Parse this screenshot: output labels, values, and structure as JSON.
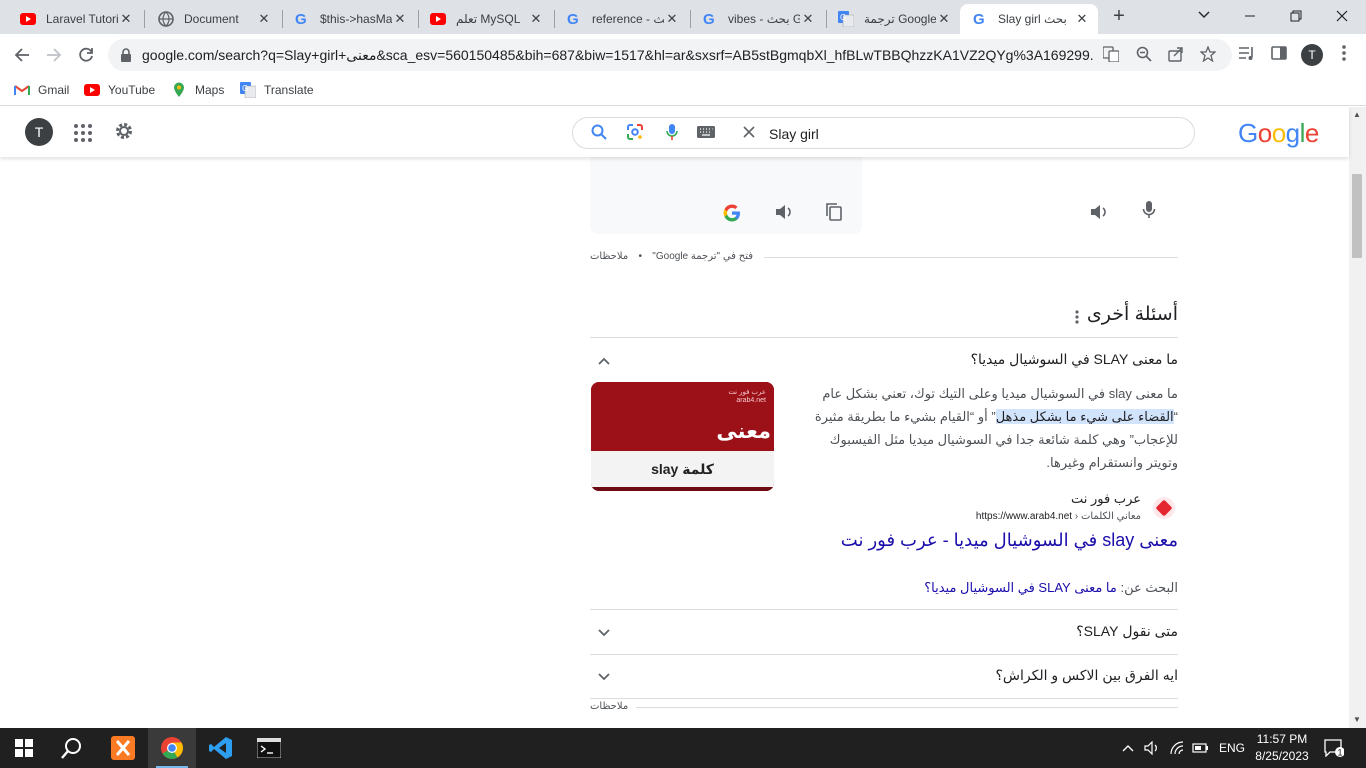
{
  "browser": {
    "tabs": [
      {
        "title": "Laravel Tutori",
        "favicon": "youtube-icon",
        "active": false
      },
      {
        "title": "Document",
        "favicon": "globe-icon",
        "active": false
      },
      {
        "title": "$this->hasMa",
        "favicon": "google-icon",
        "active": false
      },
      {
        "title": "تعلم MySQL",
        "favicon": "youtube-icon",
        "active": false
      },
      {
        "title": "reference - بحث",
        "favicon": "google-icon",
        "active": false
      },
      {
        "title": "vibes - بحث G",
        "favicon": "google-icon",
        "active": false
      },
      {
        "title": "ترجمة Google",
        "favicon": "google-translate-icon",
        "active": false
      },
      {
        "title": "Slay girl بحث",
        "favicon": "google-icon",
        "active": true
      }
    ],
    "new_tab_symbol": "+",
    "url": "google.com/search?q=Slay+girl+معنى&sca_esv=560150485&bih=687&biw=1517&hl=ar&sxsrf=AB5stBgmqbXl_hfBLwTBBQhzzKA1VZ2QYg%3A169299...",
    "profile_initial": "T",
    "bookmarks": [
      {
        "label": "Gmail",
        "icon": "gmail-icon"
      },
      {
        "label": "YouTube",
        "icon": "youtube-icon"
      },
      {
        "label": "Maps",
        "icon": "maps-pin-icon"
      },
      {
        "label": "Translate",
        "icon": "google-translate-icon"
      }
    ]
  },
  "google": {
    "account_initial": "T",
    "query": "Slay girl",
    "logo": "Google",
    "logo_colors": [
      "#4285F4",
      "#EA4335",
      "#FBBC05",
      "#4285F4",
      "#34A853",
      "#EA4335"
    ]
  },
  "translate_card": {
    "open_in": "فتح في \"ترجمة Google\"",
    "separator": "•",
    "feedback": "ملاحظات"
  },
  "paa": {
    "title": "أسئلة أخرى",
    "questions": [
      {
        "text": "ما معنى SLAY في السوشيال ميديا؟",
        "expanded": true
      },
      {
        "text": "متى نقول SLAY؟",
        "expanded": false
      },
      {
        "text": "ايه الفرق بين الاكس و الكراش؟",
        "expanded": false
      }
    ],
    "answer_before": "ما معنى slay في السوشيال ميديا وعلى التيك توك، تعني بشكل عام “",
    "answer_highlight": "القضاء على شيء ما بشكل مذهل",
    "answer_after": "” أو “القيام بشيء ما بطريقة مثيرة للإعجاب” وهي كلمة شائعة جدا في السوشيال ميديا مثل الفيسبوك وتويتر وانستقرام وغيرها.",
    "thumbnail": {
      "brand_line1": "عرب فور نت",
      "brand_line2": "arab4.net",
      "big_text": "معنى",
      "bar_text": "كلمة slay"
    },
    "source_name": "عرب فور نت",
    "source_url": "https://www.arab4.net",
    "source_path": " › معاني الكلمات",
    "result_link": "معنى slay في السوشيال ميديا - عرب فور نت",
    "search_for_label": "البحث عن: ",
    "search_for_link": "ما معنى SLAY في السوشيال ميديا؟",
    "feedback": "ملاحظات"
  },
  "taskbar": {
    "language": "ENG",
    "time": "11:57 PM",
    "date": "8/25/2023",
    "notification_count": "1"
  }
}
